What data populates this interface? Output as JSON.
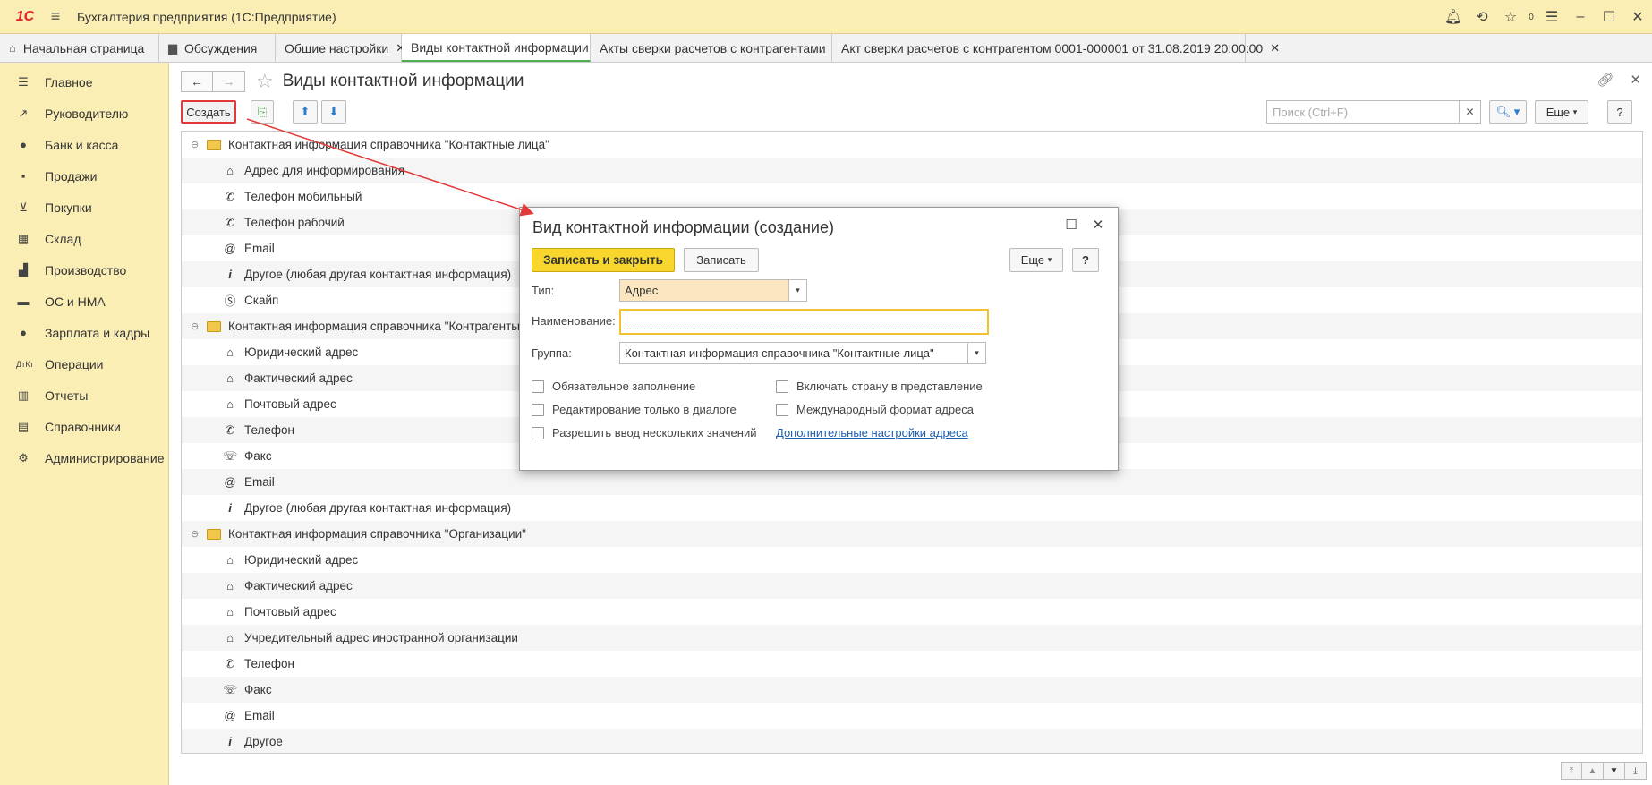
{
  "app": {
    "logo": "1С",
    "title": "Бухгалтерия предприятия  (1С:Предприятие)",
    "badge_count": "0"
  },
  "tabs": [
    {
      "label": "Начальная страница",
      "icon": "home-icon"
    },
    {
      "label": "Обсуждения",
      "icon": "chat-icon"
    },
    {
      "label": "Общие настройки"
    },
    {
      "label": "Виды контактной информации",
      "active": true
    },
    {
      "label": "Акты сверки расчетов с контрагентами"
    },
    {
      "label": "Акт сверки расчетов с контрагентом 0001-000001 от 31.08.2019 20:00:00"
    }
  ],
  "sidebar": {
    "items": [
      {
        "label": "Главное",
        "icon": "menu-icon"
      },
      {
        "label": "Руководителю",
        "icon": "trend-icon"
      },
      {
        "label": "Банк и касса",
        "icon": "ruble-icon"
      },
      {
        "label": "Продажи",
        "icon": "bag-icon"
      },
      {
        "label": "Покупки",
        "icon": "cart-icon"
      },
      {
        "label": "Склад",
        "icon": "warehouse-icon"
      },
      {
        "label": "Производство",
        "icon": "factory-icon"
      },
      {
        "label": "ОС и НМА",
        "icon": "truck-icon"
      },
      {
        "label": "Зарплата и кадры",
        "icon": "person-icon"
      },
      {
        "label": "Операции",
        "icon": "dtkt-icon"
      },
      {
        "label": "Отчеты",
        "icon": "bar-chart-icon"
      },
      {
        "label": "Справочники",
        "icon": "book-icon"
      },
      {
        "label": "Администрирование",
        "icon": "gear-icon"
      }
    ]
  },
  "page": {
    "title": "Виды контактной информации"
  },
  "toolbar": {
    "create_label": "Создать",
    "search_placeholder": "Поиск (Ctrl+F)",
    "more_label": "Еще",
    "help_label": "?"
  },
  "tree": [
    {
      "type": "group",
      "label": "Контактная информация справочника \"Контактные лица\""
    },
    {
      "type": "item",
      "icon": "address-icon",
      "label": "Адрес для информирования"
    },
    {
      "type": "item",
      "icon": "phone-icon",
      "label": "Телефон мобильный"
    },
    {
      "type": "item",
      "icon": "phone-icon",
      "label": "Телефон рабочий"
    },
    {
      "type": "item",
      "icon": "email-icon",
      "label": "Email"
    },
    {
      "type": "item",
      "icon": "info-icon",
      "label": "Другое (любая другая контактная информация)"
    },
    {
      "type": "item",
      "icon": "skype-icon",
      "label": "Скайп"
    },
    {
      "type": "group",
      "label": "Контактная информация справочника \"Контрагенты\""
    },
    {
      "type": "item",
      "icon": "address-icon",
      "label": "Юридический адрес"
    },
    {
      "type": "item",
      "icon": "address-icon",
      "label": "Фактический адрес"
    },
    {
      "type": "item",
      "icon": "address-icon",
      "label": "Почтовый адрес"
    },
    {
      "type": "item",
      "icon": "phone-icon",
      "label": "Телефон"
    },
    {
      "type": "item",
      "icon": "fax-icon",
      "label": "Факс"
    },
    {
      "type": "item",
      "icon": "email-icon",
      "label": "Email"
    },
    {
      "type": "item",
      "icon": "info-icon",
      "label": "Другое (любая другая контактная информация)"
    },
    {
      "type": "group",
      "label": "Контактная информация справочника \"Организации\""
    },
    {
      "type": "item",
      "icon": "address-icon",
      "label": "Юридический адрес"
    },
    {
      "type": "item",
      "icon": "address-icon",
      "label": "Фактический адрес"
    },
    {
      "type": "item",
      "icon": "address-icon",
      "label": "Почтовый адрес"
    },
    {
      "type": "item",
      "icon": "address-icon",
      "label": "Учредительный адрес иностранной организации"
    },
    {
      "type": "item",
      "icon": "phone-icon",
      "label": "Телефон"
    },
    {
      "type": "item",
      "icon": "fax-icon",
      "label": "Факс"
    },
    {
      "type": "item",
      "icon": "email-icon",
      "label": "Email"
    },
    {
      "type": "item",
      "icon": "info-icon",
      "label": "Другое"
    }
  ],
  "dialog": {
    "title": "Вид контактной информации (создание)",
    "save_close_label": "Записать и закрыть",
    "save_label": "Записать",
    "more_label": "Еще",
    "help_label": "?",
    "type_label": "Тип:",
    "type_value": "Адрес",
    "name_label": "Наименование:",
    "name_value": "",
    "group_label": "Группа:",
    "group_value": "Контактная информация справочника \"Контактные лица\"",
    "checkboxes_left": [
      {
        "label": "Обязательное заполнение",
        "checked": false
      },
      {
        "label": "Редактирование только в диалоге",
        "checked": false
      },
      {
        "label": "Разрешить ввод нескольких значений",
        "checked": false
      }
    ],
    "checkboxes_right": [
      {
        "label": "Включать страну в представление",
        "checked": false
      },
      {
        "label": "Международный формат адреса",
        "checked": false
      }
    ],
    "link_label": "Дополнительные настройки адреса"
  },
  "colors": {
    "panel_bg": "#fbeeb4",
    "accent_yellow": "#f8d62d",
    "annotation_red": "#e23a3a",
    "active_tab_underline": "#4caf50",
    "link": "#1d5fb0"
  }
}
